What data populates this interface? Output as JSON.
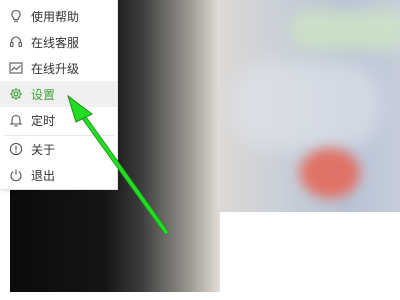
{
  "menu": {
    "items": [
      {
        "label": "使用帮助",
        "icon": "lightbulb-icon"
      },
      {
        "label": "在线客服",
        "icon": "headset-icon"
      },
      {
        "label": "在线升级",
        "icon": "chart-upgrade-icon"
      },
      {
        "label": "设置",
        "icon": "gear-icon",
        "active": true
      },
      {
        "label": "定时",
        "icon": "bell-icon"
      },
      {
        "label": "关于",
        "icon": "info-icon"
      },
      {
        "label": "退出",
        "icon": "power-icon"
      }
    ]
  },
  "colors": {
    "accent": "#3ca33a",
    "arrow": "#22dd22",
    "menu_bg": "#ffffff",
    "active_bg": "#f0f0f0"
  }
}
